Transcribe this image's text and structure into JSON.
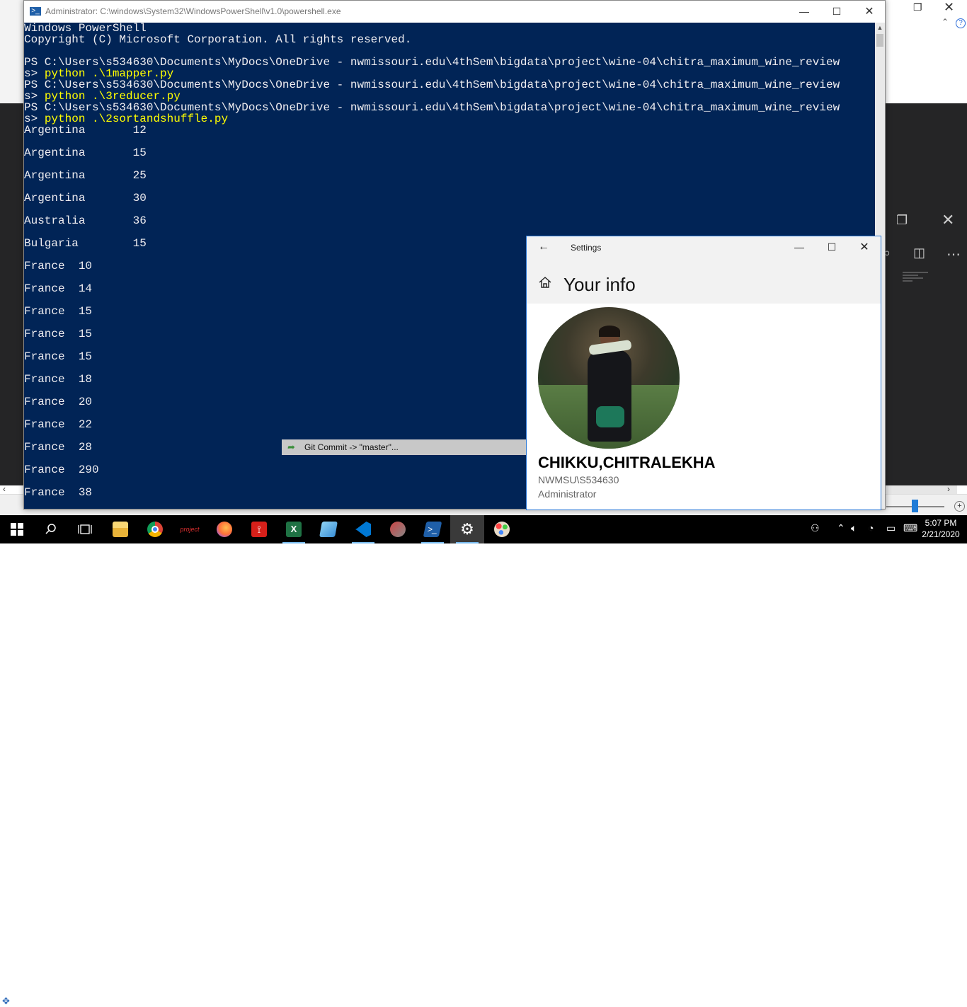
{
  "powershell": {
    "title": "Administrator: C:\\windows\\System32\\WindowsPowerShell\\v1.0\\powershell.exe",
    "banner_line1": "Windows PowerShell",
    "banner_line2": "Copyright (C) Microsoft Corporation. All rights reserved.",
    "prompt_line": "PS C:\\Users\\s534630\\Documents\\MyDocs\\OneDrive - nwmissouri.edu\\4thSem\\bigdata\\project\\wine-04\\chitra_maximum_wine_review",
    "prompt_cont": "s> ",
    "commands": [
      "python .\\1mapper.py",
      "python .\\3reducer.py",
      "python .\\2sortandshuffle.py"
    ],
    "output": [
      "Argentina       12",
      "Argentina       15",
      "Argentina       25",
      "Argentina       30",
      "Australia       36",
      "Bulgaria        15",
      "France  10",
      "France  14",
      "France  15",
      "France  15",
      "France  15",
      "France  18",
      "France  20",
      "France  22",
      "France  28",
      "France  290",
      "France  38"
    ]
  },
  "settings": {
    "window_title": "Settings",
    "heading": "Your info",
    "user_name": "CHIKKU,CHITRALEKHA",
    "account": "NWMSU\\S534630",
    "role": "Administrator"
  },
  "git_notification": {
    "text": "Git Commit -> \"master\"..."
  },
  "taskbar": {
    "project_label": "project",
    "time": "5:07 PM",
    "date": "2/21/2020"
  },
  "colors": {
    "ps_background": "#012456",
    "ps_command": "#ffff00",
    "settings_accent": "#2b78d6"
  }
}
